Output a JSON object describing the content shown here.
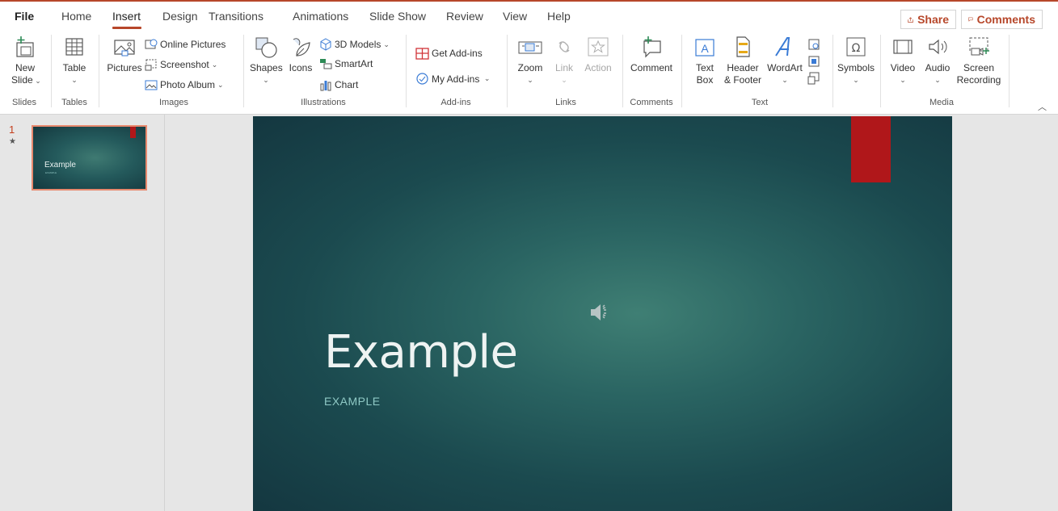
{
  "tabs": [
    "File",
    "Home",
    "Insert",
    "Design",
    "Transitions",
    "Animations",
    "Slide Show",
    "Review",
    "View",
    "Help"
  ],
  "active_tab": "Insert",
  "share_label": "Share",
  "comments_label": "Comments",
  "ribbon": {
    "slides": {
      "new_slide": [
        "New",
        "Slide"
      ],
      "group": "Slides"
    },
    "tables": {
      "table": "Table",
      "group": "Tables"
    },
    "images": {
      "pictures": "Pictures",
      "online_pictures": "Online Pictures",
      "screenshot": "Screenshot",
      "photo_album": "Photo Album",
      "group": "Images"
    },
    "illustrations": {
      "shapes": "Shapes",
      "icons": "Icons",
      "models3d": "3D Models",
      "smartart": "SmartArt",
      "chart": "Chart",
      "group": "Illustrations"
    },
    "addins": {
      "get": "Get Add-ins",
      "my": "My Add-ins",
      "group": "Add-ins"
    },
    "links": {
      "zoom": "Zoom",
      "link": "Link",
      "action": "Action",
      "group": "Links"
    },
    "comments": {
      "comment": "Comment",
      "group": "Comments"
    },
    "text": {
      "textbox": [
        "Text",
        "Box"
      ],
      "header": [
        "Header",
        "& Footer"
      ],
      "wordart": "WordArt",
      "group": "Text"
    },
    "symbols": {
      "symbols": "Symbols"
    },
    "media": {
      "video": "Video",
      "audio": "Audio",
      "screen": [
        "Screen",
        "Recording"
      ],
      "group": "Media"
    }
  },
  "thumbnail": {
    "number": "1",
    "title": "Example",
    "subtitle": "EXAMPLE"
  },
  "slide": {
    "title": "Example",
    "subtitle": "EXAMPLE"
  },
  "colors": {
    "accent": "#b7472a",
    "slide_red": "#b0171a",
    "slide_bg": "#1b4a4f"
  }
}
